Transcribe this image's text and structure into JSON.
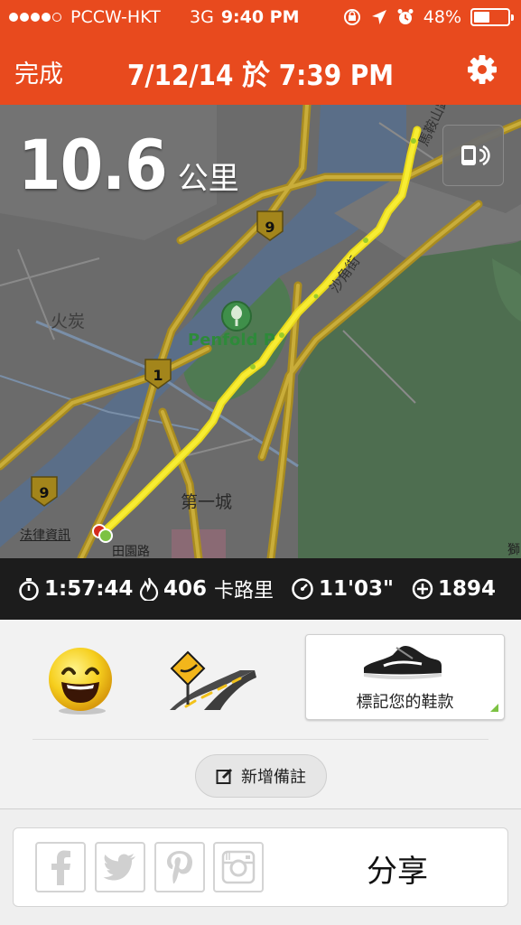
{
  "status_bar": {
    "carrier": "PCCW-HKT",
    "network": "3G",
    "time": "9:40 PM",
    "battery": "48%",
    "battery_level": 0.48,
    "icons": [
      "lock-rotation-icon",
      "location-arrow-icon",
      "alarm-icon"
    ]
  },
  "nav": {
    "done_label": "完成",
    "title": "7/12/14 於 7:39 PM",
    "settings_icon": "gear-icon"
  },
  "map": {
    "distance_value": "10.6",
    "distance_unit": "公里",
    "labels": {
      "fo_tan": "火炭",
      "park": "Penfold P",
      "ma_liu_shui": "馬鞍山路",
      "sha_kok": "沙角街",
      "first_city": "第一城",
      "legal": "法律資訊",
      "road_bottom": "田園路",
      "edge": "獅"
    },
    "route_shields": [
      "9",
      "1",
      "9"
    ],
    "colors": {
      "route": "#f4e21c",
      "route_green": "#9acb2a",
      "water": "#5a6f8a",
      "green_area": "#4d6d4f",
      "road": "#b39a2c"
    }
  },
  "stats": {
    "duration": "1:57:44",
    "calories": "406",
    "calories_unit": "卡路里",
    "pace": "11'03\"",
    "fuel": "1894"
  },
  "panel": {
    "mood_icon": "happy-face-icon",
    "terrain_icon": "road-terrain-icon",
    "shoe_label": "標記您的鞋款",
    "add_note_label": "新增備註"
  },
  "share": {
    "label": "分享",
    "icons": [
      "facebook-icon",
      "twitter-icon",
      "pinterest-icon",
      "instagram-icon"
    ]
  }
}
